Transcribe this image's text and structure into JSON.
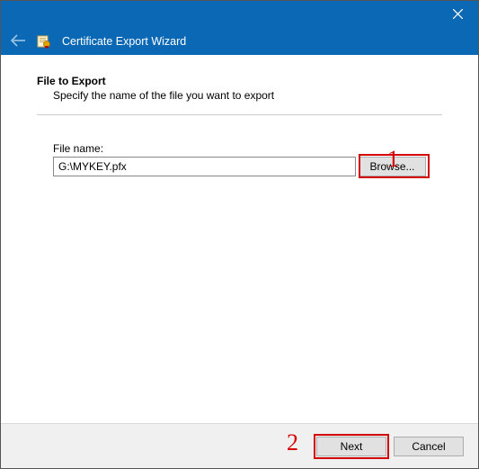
{
  "window": {
    "title": "Certificate Export Wizard"
  },
  "page": {
    "heading": "File to Export",
    "description": "Specify the name of the file you want to export"
  },
  "file": {
    "label": "File name:",
    "value": "G:\\MYKEY.pfx",
    "browse_label": "Browse..."
  },
  "footer": {
    "next_label": "Next",
    "cancel_label": "Cancel"
  },
  "annotations": {
    "one": "1",
    "two": "2"
  }
}
